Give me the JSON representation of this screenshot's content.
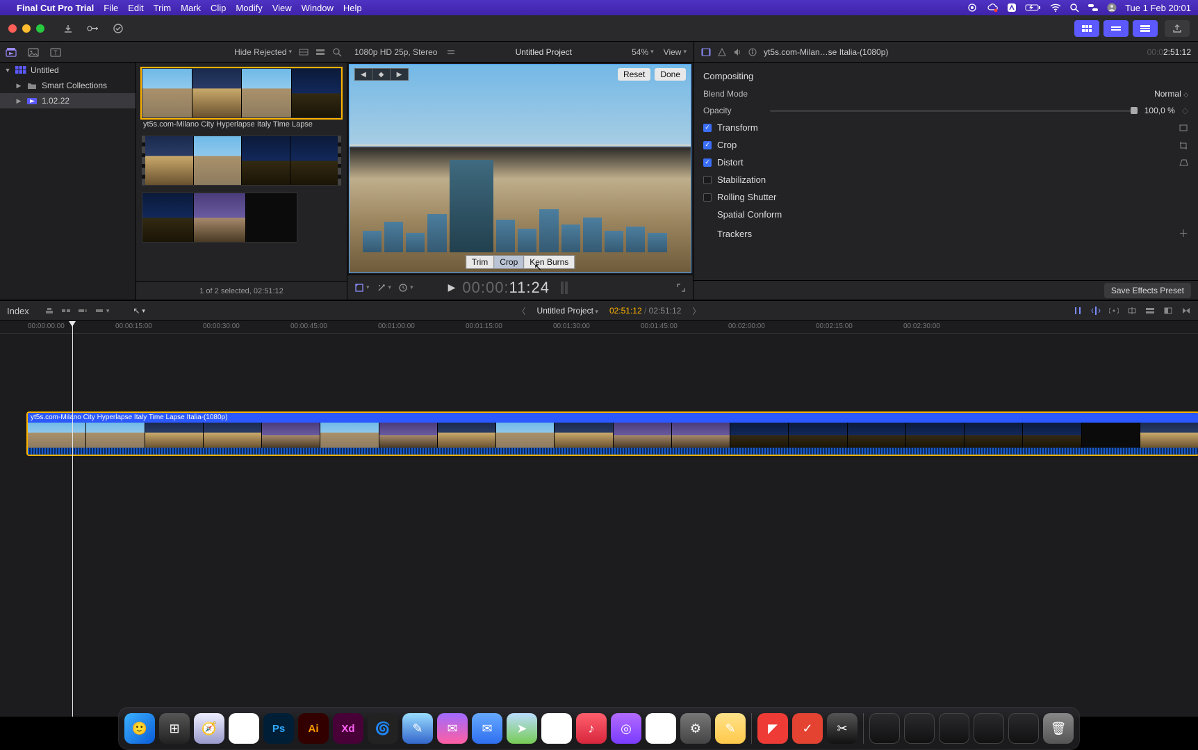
{
  "os_menubar": {
    "app_name": "Final Cut Pro Trial",
    "menus": [
      "File",
      "Edit",
      "Trim",
      "Mark",
      "Clip",
      "Modify",
      "View",
      "Window",
      "Help"
    ],
    "clock": "Tue 1 Feb  20:01",
    "status_icons": [
      "record-icon",
      "sync-icon",
      "dropbox-icon",
      "battery-icon",
      "wifi-icon",
      "search-icon",
      "control-center-icon",
      "user-icon"
    ]
  },
  "toolbar": {
    "hide_rejected": "Hide Rejected",
    "project_format": "1080p HD 25p, Stereo",
    "project_name": "Untitled Project",
    "zoom_pct": "54%",
    "view_label": "View"
  },
  "sidebar": {
    "library": "Untitled",
    "items": [
      {
        "label": "Smart Collections"
      },
      {
        "label": "1.02.22"
      }
    ]
  },
  "browser": {
    "clips": [
      {
        "label": "yt5s.com-Milano City Hyperlapse Italy Time Lapse",
        "selected": true
      },
      {
        "label": "",
        "selected": false
      },
      {
        "label": "",
        "selected": false
      }
    ],
    "footer": "1 of 2 selected, 02:51:12"
  },
  "viewer": {
    "reset": "Reset",
    "done": "Done",
    "crop_modes": [
      "Trim",
      "Crop",
      "Ken Burns"
    ],
    "crop_mode_selected": 1,
    "timecode_dim": "00:00:",
    "timecode_bright": "11:24"
  },
  "inspector": {
    "clip_name": "yt5s.com-Milan…se Italia-(1080p)",
    "duration": "2:51:12",
    "duration_prefix_dim": "00:0",
    "sections": {
      "compositing": "Compositing",
      "blend_mode_label": "Blend Mode",
      "blend_mode_value": "Normal",
      "opacity_label": "Opacity",
      "opacity_value": "100,0  %",
      "transform": "Transform",
      "crop": "Crop",
      "distort": "Distort",
      "stabilization": "Stabilization",
      "rolling_shutter": "Rolling Shutter",
      "spatial_conform": "Spatial Conform",
      "trackers": "Trackers"
    },
    "save_preset": "Save Effects Preset"
  },
  "timeline": {
    "index_label": "Index",
    "project_name": "Untitled Project",
    "total_tc": "02:51:12",
    "range_tc": "02:51:12",
    "ruler": [
      "00:00:00:00",
      "00:00:15:00",
      "00:00:30:00",
      "00:00:45:00",
      "00:01:00:00",
      "00:01:15:00",
      "00:01:30:00",
      "00:01:45:00",
      "00:02:00:00",
      "00:02:15:00",
      "00:02:30:00"
    ],
    "clip_label": "yt5s.com-Milano City Hyperlapse Italy Time Lapse Italia-(1080p)"
  },
  "dock": {
    "apps": [
      {
        "name": "finder",
        "bg": "linear-gradient(135deg,#3bb2ff,#0a5bd6)",
        "glyph": "🙂"
      },
      {
        "name": "launchpad",
        "bg": "linear-gradient(#555,#222)",
        "glyph": "⊞"
      },
      {
        "name": "safari",
        "bg": "linear-gradient(#eef,#99c)",
        "glyph": "🧭"
      },
      {
        "name": "chrome",
        "bg": "#fff",
        "glyph": "◉"
      },
      {
        "name": "photoshop",
        "bg": "#001e36",
        "glyph": "Ps"
      },
      {
        "name": "illustrator",
        "bg": "#330000",
        "glyph": "Ai"
      },
      {
        "name": "xd",
        "bg": "#470137",
        "glyph": "Xd"
      },
      {
        "name": "blender",
        "bg": "#222",
        "glyph": "🌀"
      },
      {
        "name": "kiwi",
        "bg": "linear-gradient(#9df,#36c)",
        "glyph": "✎"
      },
      {
        "name": "messenger",
        "bg": "linear-gradient(#a06bff,#ff5fa2)",
        "glyph": "✉"
      },
      {
        "name": "mail",
        "bg": "linear-gradient(#66aaff,#2e6ef0)",
        "glyph": "✉"
      },
      {
        "name": "maps",
        "bg": "linear-gradient(#bdf,#7c5)",
        "glyph": "➤"
      },
      {
        "name": "photos",
        "bg": "#fff",
        "glyph": "✿"
      },
      {
        "name": "music",
        "bg": "linear-gradient(#ff5f6d,#d7263d)",
        "glyph": "♪"
      },
      {
        "name": "podcasts",
        "bg": "linear-gradient(#b36bff,#7a3bff)",
        "glyph": "◎"
      },
      {
        "name": "numbers",
        "bg": "#fff",
        "glyph": "≡"
      },
      {
        "name": "settings",
        "bg": "linear-gradient(#777,#444)",
        "glyph": "⚙"
      },
      {
        "name": "notes",
        "bg": "linear-gradient(#ffe28a,#ffc94a)",
        "glyph": "✎"
      }
    ],
    "after_sep": [
      {
        "name": "anydesk",
        "bg": "#ef3b36",
        "glyph": "◤"
      },
      {
        "name": "todoist",
        "bg": "#e44332",
        "glyph": "✓"
      },
      {
        "name": "finalcut",
        "bg": "linear-gradient(#555,#111)",
        "glyph": "✂"
      }
    ],
    "minimized_count": 5,
    "trash": {
      "name": "trash",
      "bg": "linear-gradient(#888,#555)",
      "glyph": "🗑"
    }
  }
}
